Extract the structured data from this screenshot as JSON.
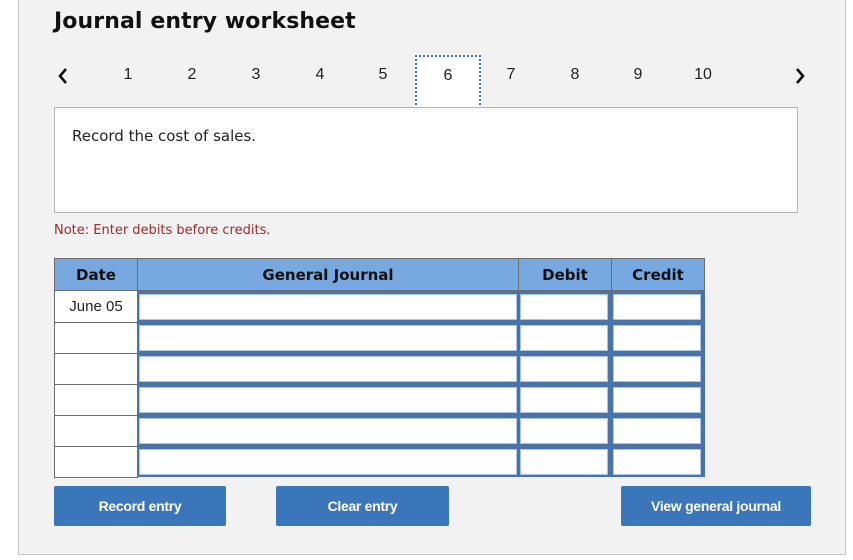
{
  "worksheet": {
    "title": "Journal entry worksheet",
    "nav": {
      "prev_icon": "chevron-left-icon",
      "next_icon": "chevron-right-icon",
      "steps": [
        "1",
        "2",
        "3",
        "4",
        "5",
        "6",
        "7",
        "8",
        "9",
        "10"
      ],
      "active_step": "6"
    },
    "instruction": "Record the cost of sales.",
    "note": "Note: Enter debits before credits.",
    "table": {
      "headers": [
        "Date",
        "General Journal",
        "Debit",
        "Credit"
      ],
      "rows": [
        {
          "date": "June 05",
          "account": "",
          "debit": "",
          "credit": ""
        },
        {
          "date": "",
          "account": "",
          "debit": "",
          "credit": ""
        },
        {
          "date": "",
          "account": "",
          "debit": "",
          "credit": ""
        },
        {
          "date": "",
          "account": "",
          "debit": "",
          "credit": ""
        },
        {
          "date": "",
          "account": "",
          "debit": "",
          "credit": ""
        },
        {
          "date": "",
          "account": "",
          "debit": "",
          "credit": ""
        }
      ]
    },
    "buttons": {
      "record": "Record entry",
      "clear": "Clear entry",
      "view": "View general journal"
    }
  },
  "colors": {
    "header_bg": "#77a9e0",
    "button_bg": "#3b76ba",
    "note_text": "#9e2a2a",
    "active_step_border": "#3b73b9"
  }
}
